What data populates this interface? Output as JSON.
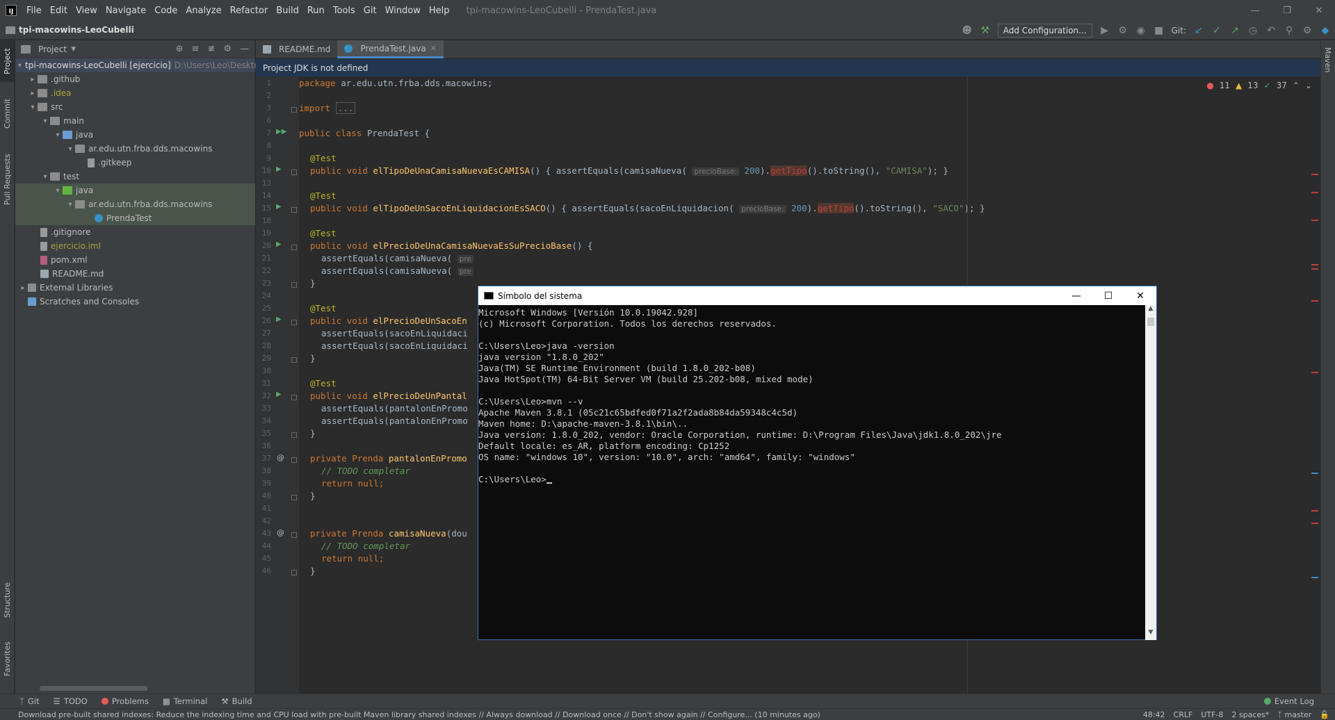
{
  "menubar": {
    "items": [
      "File",
      "Edit",
      "View",
      "Navigate",
      "Code",
      "Analyze",
      "Refactor",
      "Build",
      "Run",
      "Tools",
      "Git",
      "Window",
      "Help"
    ],
    "window_title": "tpi-macowins-LeoCubelli - PrendaTest.java"
  },
  "navbar": {
    "project_name": "tpi-macowins-LeoCubelli",
    "add_configuration": "Add Configuration...",
    "git_label": "Git:"
  },
  "left_stripe": {
    "project": "Project",
    "commit": "Commit",
    "pull_requests": "Pull Requests",
    "structure": "Structure",
    "favorites": "Favorites"
  },
  "right_stripe": {
    "maven": "Maven"
  },
  "project_panel": {
    "title": "Project",
    "tree": [
      {
        "label": "tpi-macowins-LeoCubelli [ejercicio]",
        "path": "D:\\Users\\Leo\\Deskto"
      },
      {
        "label": ".github"
      },
      {
        "label": ".idea"
      },
      {
        "label": "src"
      },
      {
        "label": "main"
      },
      {
        "label": "java"
      },
      {
        "label": "ar.edu.utn.frba.dds.macowins"
      },
      {
        "label": ".gitkeep"
      },
      {
        "label": "test"
      },
      {
        "label": "java"
      },
      {
        "label": "ar.edu.utn.frba.dds.macowins"
      },
      {
        "label": "PrendaTest"
      },
      {
        "label": ".gitignore"
      },
      {
        "label": "ejercicio.iml"
      },
      {
        "label": "pom.xml"
      },
      {
        "label": "README.md"
      },
      {
        "label": "External Libraries"
      },
      {
        "label": "Scratches and Consoles"
      }
    ]
  },
  "editor": {
    "tabs": [
      {
        "label": "README.md"
      },
      {
        "label": "PrendaTest.java"
      }
    ],
    "banner": "Project JDK is not defined",
    "inspection": {
      "errors": "11",
      "warnings": "13",
      "ok": "37"
    },
    "line_numbers": [
      "1",
      "2",
      "3",
      "6",
      "7",
      "8",
      "9",
      "10",
      "13",
      "14",
      "15",
      "18",
      "19",
      "20",
      "21",
      "22",
      "23",
      "24",
      "25",
      "26",
      "27",
      "28",
      "29",
      "30",
      "31",
      "32",
      "33",
      "34",
      "35",
      "36",
      "37",
      "38",
      "39",
      "40",
      "41",
      "42",
      "43",
      "44",
      "45",
      "46"
    ]
  },
  "code": {
    "package_kw": "package",
    "package_name": " ar.edu.utn.frba.dds.macowins;",
    "import_kw": "import",
    "import_fold": "...",
    "class_decl_kw": "public class ",
    "class_name": "PrendaTest",
    "class_brace": " {",
    "test_ann": "@Test",
    "public_void": "public void ",
    "m1_name": "elTipoDeUnaCamisaNuevaEsCAMISA",
    "m1_tail_a": "() { assertEquals(camisaNueva( ",
    "m1_hint": "precioBase:",
    "m1_num": " 200",
    "m1_tail_b": ").",
    "m1_err": "getTipo",
    "m1_tail_c": "().toString(), ",
    "m1_str": "\"CAMISA\"",
    "m1_end": "); }",
    "m2_name": "elTipoDeUnSacoEnLiquidacionEsSACO",
    "m2_tail_a": "() { assertEquals(sacoEnLiquidacion( ",
    "m2_hint": "precioBase:",
    "m2_num": " 200",
    "m2_tail_b": ").",
    "m2_err": "getTipo",
    "m2_tail_c": "().toString(), ",
    "m2_str": "\"SACO\"",
    "m2_end": "); }",
    "m3_name": "elPrecioDeUnaCamisaNuevaEsSuPrecioBase",
    "m3_tail": "() {",
    "m3_l1": "assertEquals(camisaNueva( ",
    "m3_l1_hint": "pre",
    "m3_l2": "assertEquals(camisaNueva( ",
    "m3_l2_hint": "pre",
    "close_brace": "}",
    "m4_name": "elPrecioDeUnSacoEn",
    "m4_l1": "assertEquals(sacoEnLiquidaci",
    "m4_l2": "assertEquals(sacoEnLiquidaci",
    "m5_name": "elPrecioDeUnPantal",
    "m5_l1": "assertEquals(pantalonEnPromo",
    "m5_l2": "assertEquals(pantalonEnPromo",
    "private_prenda": "private Prenda ",
    "p1_name": "pantalonEnPromo",
    "todo_cmt": "// TODO completar",
    "return_null": "return null;",
    "p2_name": "camisaNueva",
    "p2_tail": "(dou"
  },
  "cmd": {
    "title": "Símbolo del sistema",
    "lines": [
      "Microsoft Windows [Versión 10.0.19042.928]",
      "(c) Microsoft Corporation. Todos los derechos reservados.",
      "",
      "C:\\Users\\Leo>java -version",
      "java version \"1.8.0_202\"",
      "Java(TM) SE Runtime Environment (build 1.8.0_202-b08)",
      "Java HotSpot(TM) 64-Bit Server VM (build 25.202-b08, mixed mode)",
      "",
      "C:\\Users\\Leo>mvn --v",
      "Apache Maven 3.8.1 (05c21c65bdfed0f71a2f2ada8b84da59348c4c5d)",
      "Maven home: D:\\apache-maven-3.8.1\\bin\\..",
      "Java version: 1.8.0_202, vendor: Oracle Corporation, runtime: D:\\Program Files\\Java\\jdk1.8.0_202\\jre",
      "Default locale: es_AR, platform encoding: Cp1252",
      "OS name: \"windows 10\", version: \"10.0\", arch: \"amd64\", family: \"windows\"",
      ""
    ],
    "prompt": "C:\\Users\\Leo>"
  },
  "bottom_tools": {
    "git": "Git",
    "todo": "TODO",
    "problems": "Problems",
    "terminal": "Terminal",
    "build": "Build",
    "event_log": "Event Log"
  },
  "statusbar": {
    "message": "Download pre-built shared indexes: Reduce the indexing time and CPU load with pre-built Maven library shared indexes // Always download // Download once // Don't show again // Configure... (10 minutes ago)",
    "position": "48:42",
    "line_sep": "CRLF",
    "encoding": "UTF-8",
    "indent": "2 spaces*",
    "branch": "master"
  },
  "colors": {
    "bg": "#2b2b2b",
    "panel": "#3c3f41",
    "keyword": "#cc7832",
    "annotation": "#bbb529",
    "method": "#ffc66d",
    "string": "#6a8759",
    "number": "#6897bb",
    "accent": "#4a88c7"
  }
}
